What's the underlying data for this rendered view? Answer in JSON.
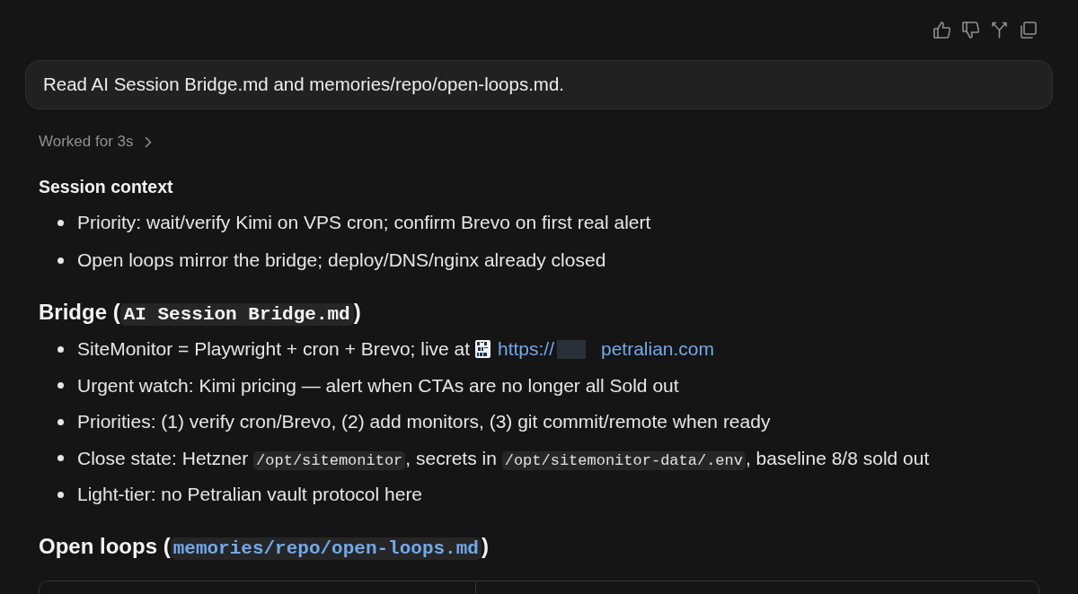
{
  "user_message": {
    "text": "Read AI Session Bridge.md and memories/repo/open-loops.md."
  },
  "worked_for": {
    "label": "Worked for 3s",
    "expanded": false
  },
  "response": [
    {
      "kind": "label",
      "text": "Session context"
    },
    {
      "kind": "bullets",
      "items": [
        {
          "segments": [
            {
              "kind": "text",
              "text": "Priority: wait/verify Kimi on VPS cron; confirm Brevo on first real alert"
            }
          ]
        },
        {
          "segments": [
            {
              "kind": "text",
              "text": "Open loops mirror the bridge; deploy/DNS/nginx already closed"
            }
          ]
        }
      ]
    },
    {
      "kind": "heading",
      "segments": [
        {
          "kind": "text",
          "text": "Bridge ("
        },
        {
          "kind": "code",
          "text": "AI Session Bridge.md"
        },
        {
          "kind": "text",
          "text": ")"
        }
      ]
    },
    {
      "kind": "bullets",
      "items": [
        {
          "segments": [
            {
              "kind": "text",
              "text": "SiteMonitor = Playwright + cron + Brevo; live at "
            },
            {
              "kind": "link",
              "text": "https://",
              "redacted": true,
              "after": "petralian.com"
            }
          ]
        },
        {
          "segments": [
            {
              "kind": "text",
              "text": "Urgent watch: Kimi pricing — alert when CTAs are no longer all Sold out"
            }
          ]
        },
        {
          "segments": [
            {
              "kind": "text",
              "text": "Priorities: (1) verify cron/Brevo, (2) add monitors, (3) git commit/remote when ready"
            }
          ]
        },
        {
          "segments": [
            {
              "kind": "text",
              "text": "Close state: Hetzner "
            },
            {
              "kind": "code",
              "text": "/opt/sitemonitor"
            },
            {
              "kind": "text",
              "text": ", secrets in "
            },
            {
              "kind": "code",
              "text": "/opt/sitemonitor-data/.env"
            },
            {
              "kind": "text",
              "text": ", baseline 8/8 sold out"
            }
          ]
        },
        {
          "segments": [
            {
              "kind": "text",
              "text": "Light-tier: no Petralian vault protocol here"
            }
          ]
        }
      ]
    },
    {
      "kind": "heading",
      "segments": [
        {
          "kind": "text",
          "text": "Open loops ("
        },
        {
          "kind": "file_link",
          "text": "memories/repo/open-loops.md"
        },
        {
          "kind": "text",
          "text": ")"
        }
      ]
    }
  ]
}
